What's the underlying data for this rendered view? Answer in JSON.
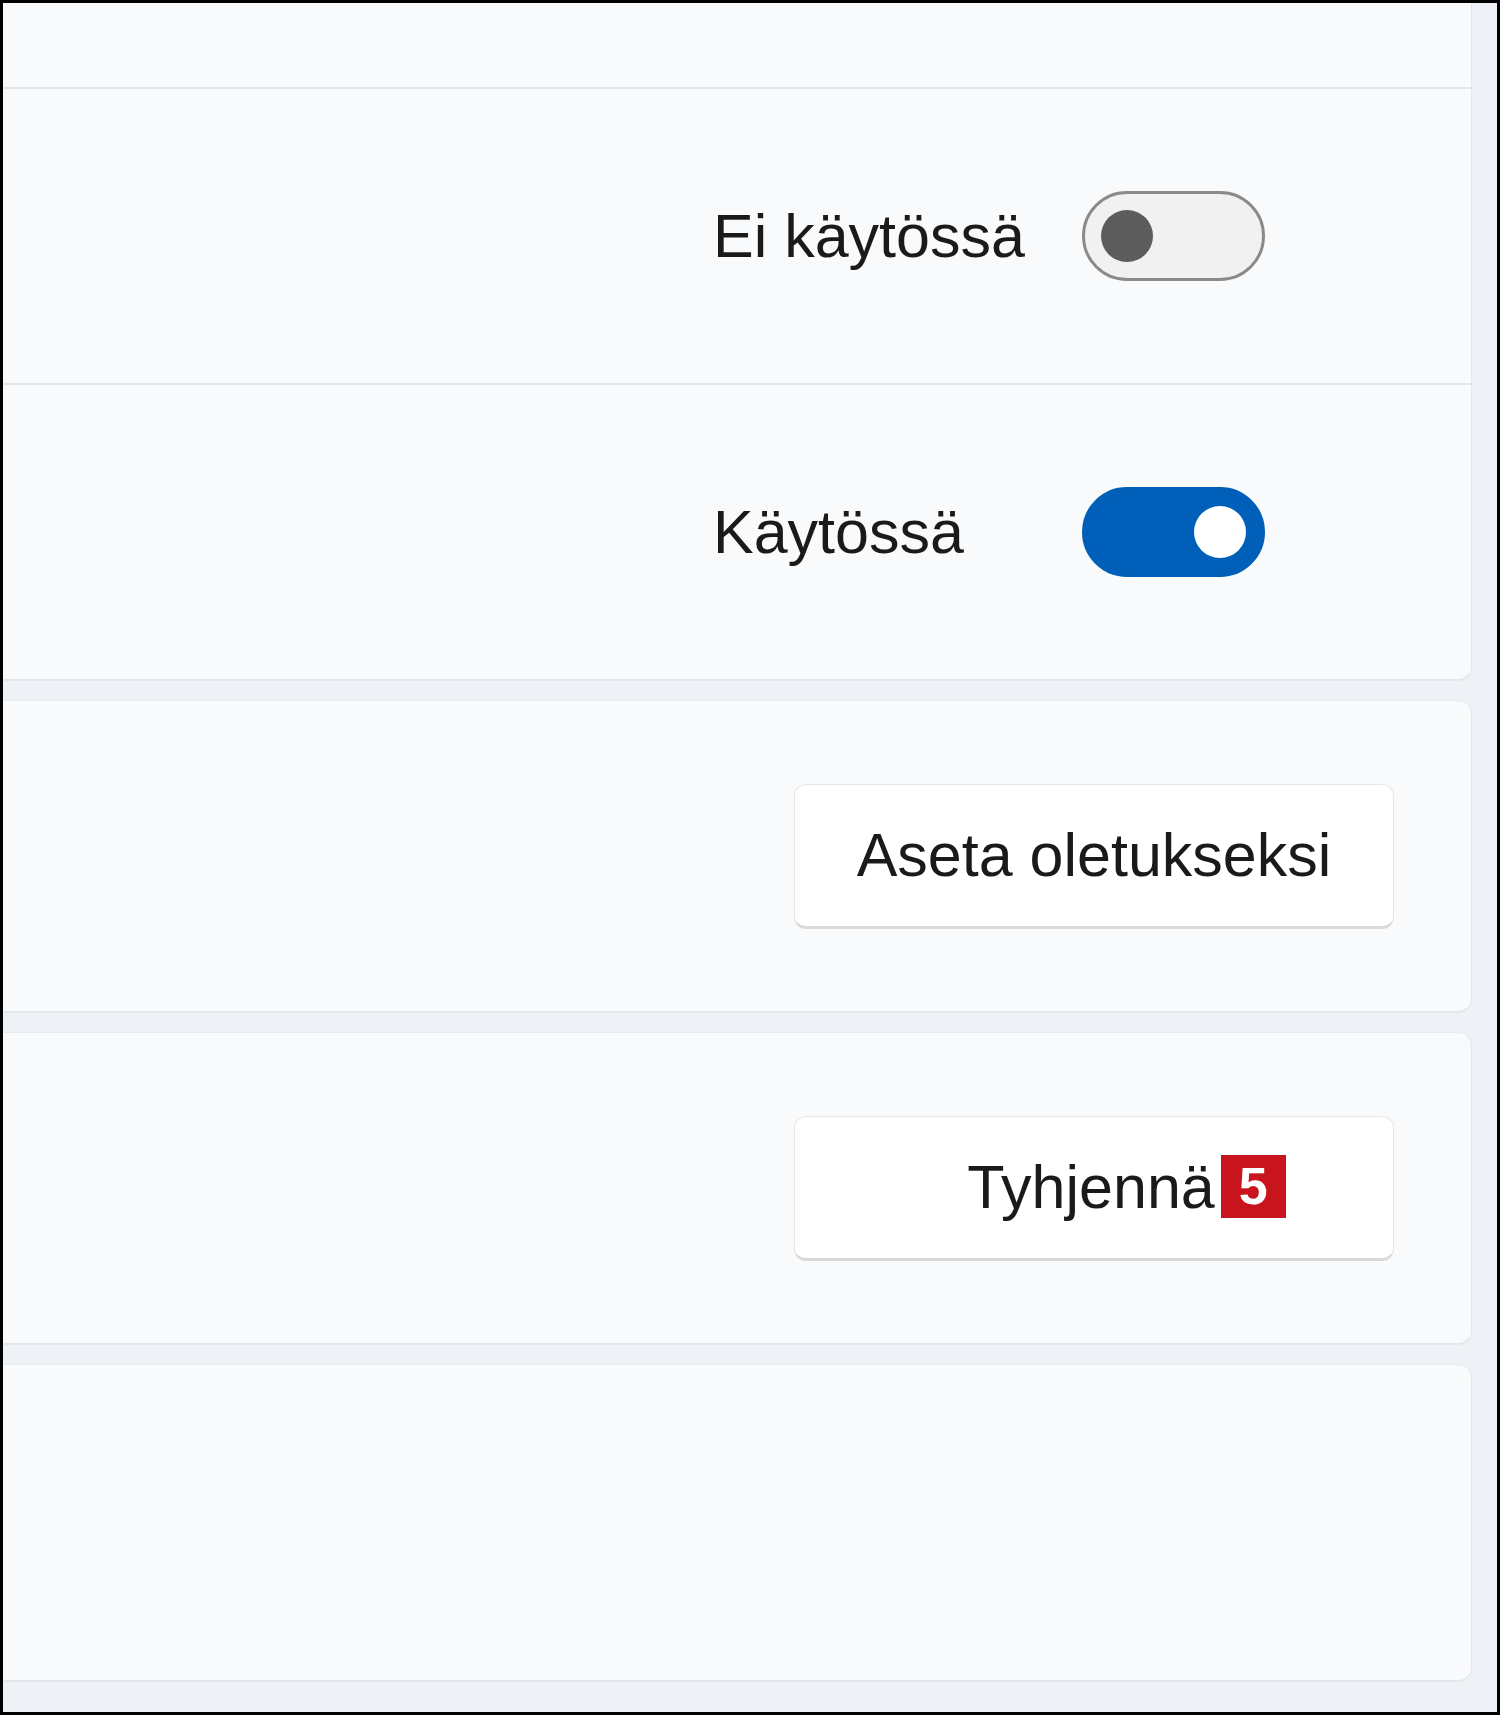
{
  "settings_group": {
    "rows": [
      {
        "kind": "empty"
      },
      {
        "kind": "toggle",
        "state_label": "Ei käytössä",
        "on": false
      },
      {
        "kind": "toggle",
        "state_label": "Käytössä",
        "on": true
      }
    ]
  },
  "cards": [
    {
      "kind": "button",
      "button": {
        "label": "Aseta oletukseksi"
      }
    },
    {
      "kind": "button",
      "button": {
        "label": "Tyhjennä",
        "badge": "5"
      }
    },
    {
      "kind": "empty"
    }
  ]
}
